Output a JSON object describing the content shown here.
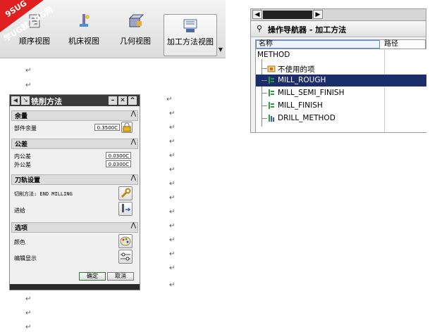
{
  "watermark": {
    "line1": "9SUG",
    "line2": "学UG就上UG网"
  },
  "toolbar": {
    "buttons": [
      {
        "label": "顺序视图"
      },
      {
        "label": "机床视图"
      },
      {
        "label": "几何视图"
      },
      {
        "label": "加工方法视图"
      }
    ]
  },
  "pilcrow": "↵",
  "dialog": {
    "title": "铣削方法",
    "sections": {
      "stock": {
        "title": "余量",
        "part_stock_label": "部件余量",
        "part_stock_value": "0.3500C"
      },
      "tolerance": {
        "title": "公差",
        "intol_label": "内公差",
        "intol_value": "0.0300C",
        "outtol_label": "外公差",
        "outtol_value": "0.0300C"
      },
      "tool_path": {
        "title": "刀轨设置",
        "cut_method_label": "切削方法: END MILLING",
        "feed_label": "进给"
      },
      "options": {
        "title": "选项",
        "color_label": "颜色",
        "display_label": "编辑显示"
      }
    },
    "ok_label": "确定",
    "cancel_label": "取消"
  },
  "navigator": {
    "title": "操作导航器 - 加工方法",
    "columns": {
      "name": "名称",
      "path": "路径"
    },
    "root": "METHOD",
    "items": [
      {
        "label": "不使用的项",
        "icon": "folder-icon"
      },
      {
        "label": "MILL_ROUGH",
        "icon": "mill-method-icon",
        "selected": true
      },
      {
        "label": "MILL_SEMI_FINISH",
        "icon": "mill-method-icon"
      },
      {
        "label": "MILL_FINISH",
        "icon": "mill-method-icon"
      },
      {
        "label": "DRILL_METHOD",
        "icon": "drill-method-icon"
      }
    ]
  },
  "colors": {
    "selection": "#1b2d6b",
    "dialog_title": "#3a3a3a",
    "watermark": "#e02020"
  }
}
